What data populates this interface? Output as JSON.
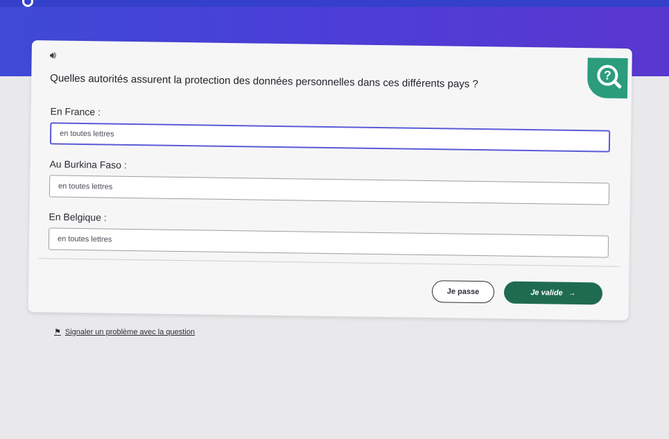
{
  "question": {
    "text": "Quelles autorités assurent la protection des données personnelles dans ces différents pays ?"
  },
  "fields": [
    {
      "label": "En France :",
      "value": "",
      "placeholder": "en toutes lettres"
    },
    {
      "label": "Au Burkina Faso :",
      "value": "",
      "placeholder": "en toutes lettres"
    },
    {
      "label": "En Belgique :",
      "value": "",
      "placeholder": "en toutes lettres"
    }
  ],
  "actions": {
    "skip_label": "Je passe",
    "validate_label": "Je valide",
    "validate_icon": "arrow-right-icon"
  },
  "report": {
    "label": "Signaler un problème avec la question",
    "icon": "flag-icon"
  },
  "colors": {
    "header": "#4a3fd8",
    "badge": "#2b9c7c",
    "validate_button": "#1f6b50"
  },
  "icons": {
    "audio": "speaker-icon",
    "badge": "question-magnifier-icon"
  }
}
